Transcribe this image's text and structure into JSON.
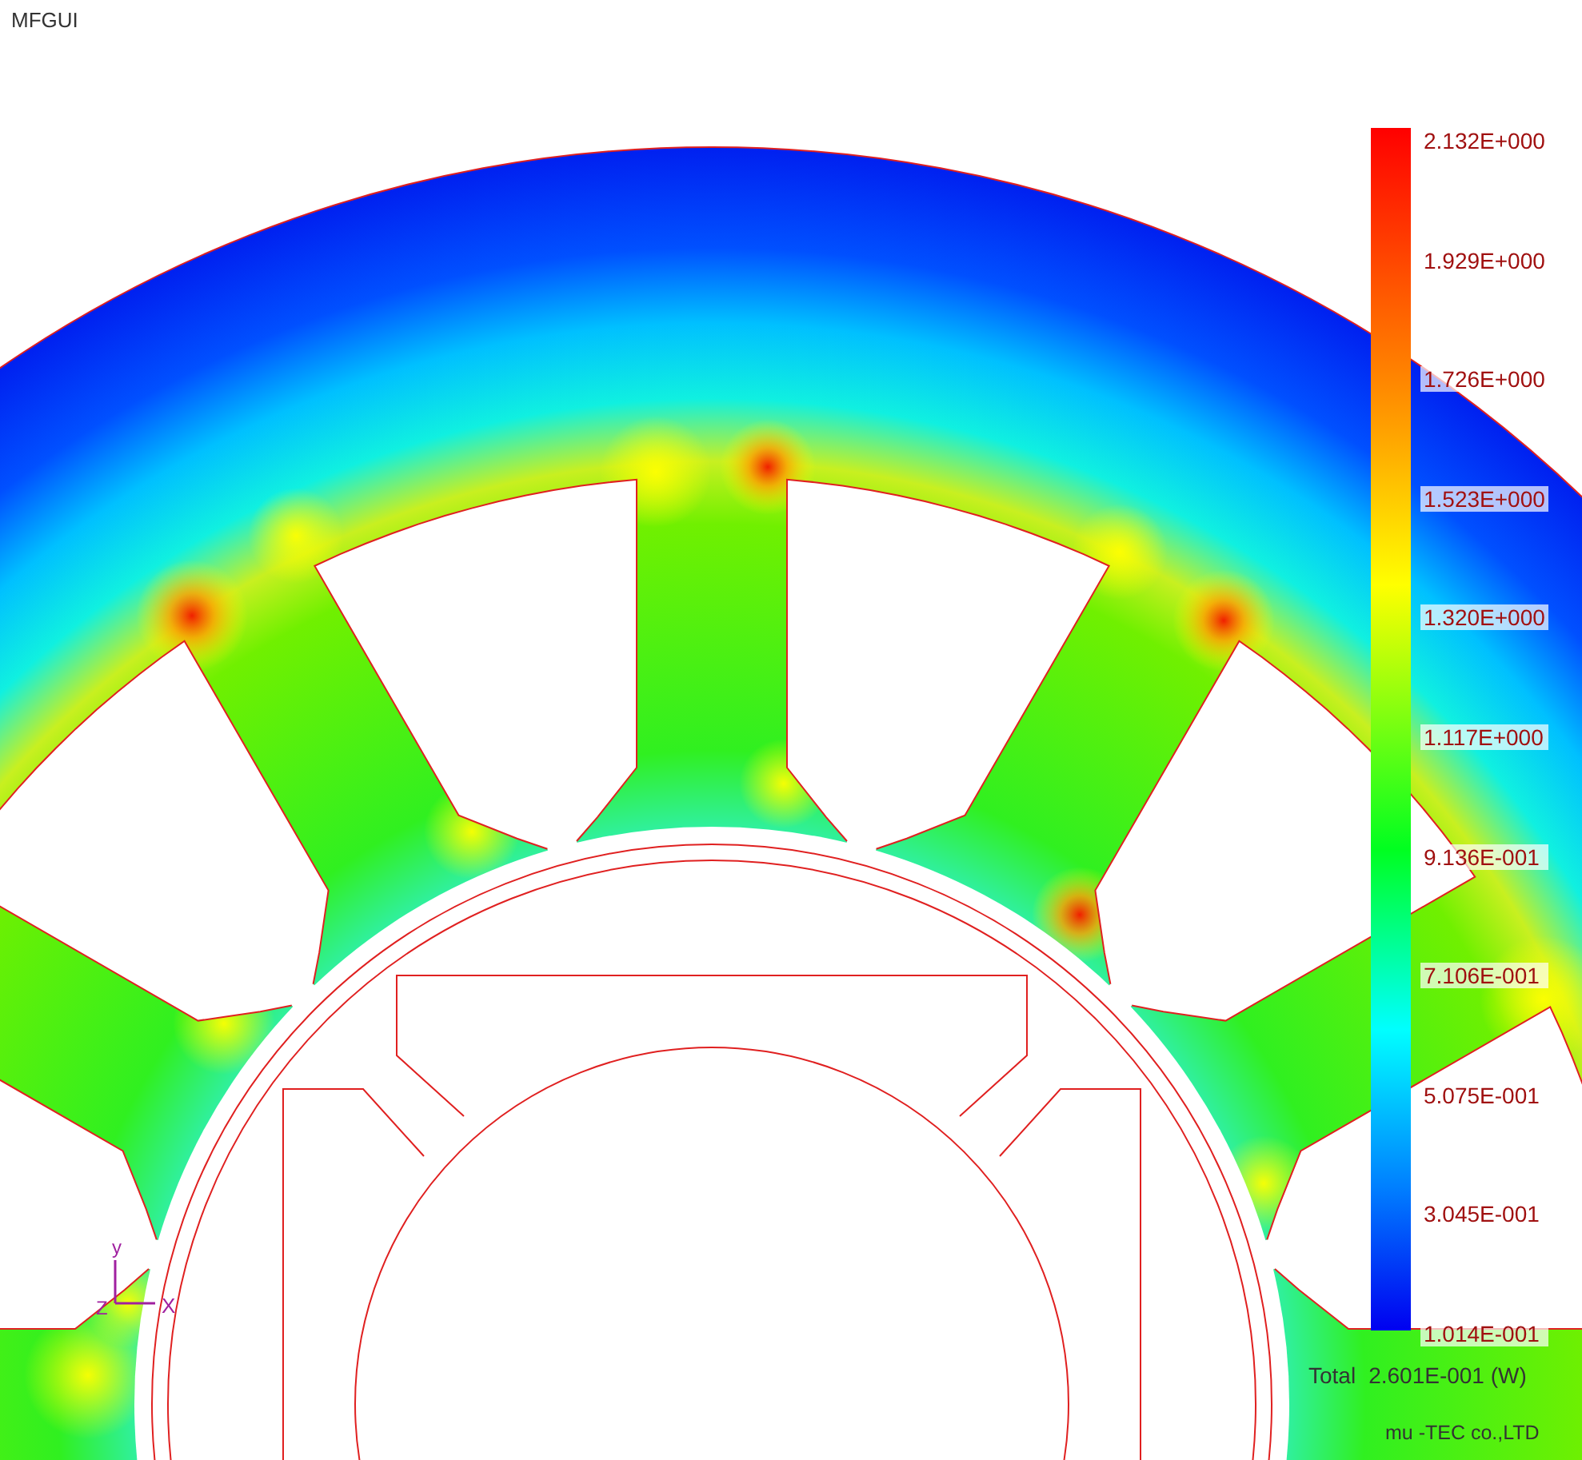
{
  "window": {
    "title": "MFGUI"
  },
  "legend": {
    "labels": [
      "2.132E+000",
      "1.929E+000",
      "1.726E+000",
      "1.523E+000",
      "1.320E+000",
      "1.117E+000",
      "9.136E-001",
      "7.106E-001",
      "5.075E-001",
      "3.045E-001",
      "1.014E-001"
    ]
  },
  "total": {
    "label": "Total",
    "value": "2.601E-001 (W)"
  },
  "axes": {
    "y": "y",
    "z": "Z",
    "x": "X"
  },
  "footer": "mu -TEC co.,LTD"
}
